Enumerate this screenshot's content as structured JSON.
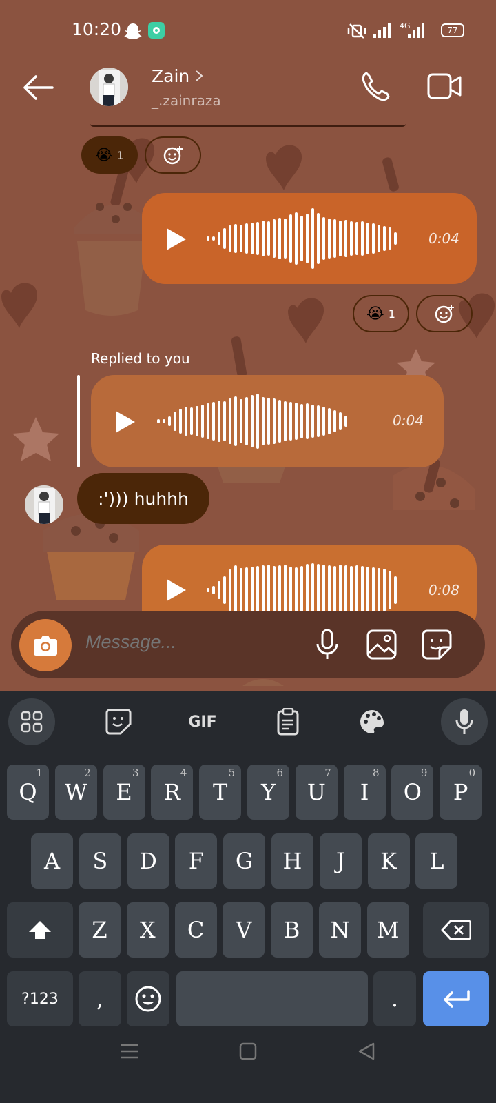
{
  "status_bar": {
    "time": "10:20",
    "network": "4G",
    "battery": "77"
  },
  "header": {
    "contact_name": "Zain",
    "contact_handle": "_.zainraza"
  },
  "messages": {
    "reaction1_count": "1",
    "voice1_duration": "0:04",
    "reaction2_count": "1",
    "replied_label": "Replied to you",
    "voice2_duration": "0:04",
    "text_message": ":'))) huhhh",
    "voice3_duration": "0:08"
  },
  "composer": {
    "placeholder": "Message..."
  },
  "keyboard": {
    "gif_label": "GIF",
    "row1": [
      {
        "k": "Q",
        "h": "1"
      },
      {
        "k": "W",
        "h": "2"
      },
      {
        "k": "E",
        "h": "3"
      },
      {
        "k": "R",
        "h": "4"
      },
      {
        "k": "T",
        "h": "5"
      },
      {
        "k": "Y",
        "h": "6"
      },
      {
        "k": "U",
        "h": "7"
      },
      {
        "k": "I",
        "h": "8"
      },
      {
        "k": "O",
        "h": "9"
      },
      {
        "k": "P",
        "h": "0"
      }
    ],
    "row2": [
      "A",
      "S",
      "D",
      "F",
      "G",
      "H",
      "J",
      "K",
      "L"
    ],
    "row3": [
      "Z",
      "X",
      "C",
      "V",
      "B",
      "N",
      "M"
    ],
    "symbols_label": "?123",
    "comma": ",",
    "period": "."
  },
  "colors": {
    "chat_bg": "#8b5340",
    "bubble_sent": "#cf6a2e",
    "bubble_received": "#b86a3a",
    "text_bubble": "#4b2608",
    "keyboard_bg": "#26292e",
    "key_bg": "#444a51",
    "enter_key": "#5890e8"
  }
}
